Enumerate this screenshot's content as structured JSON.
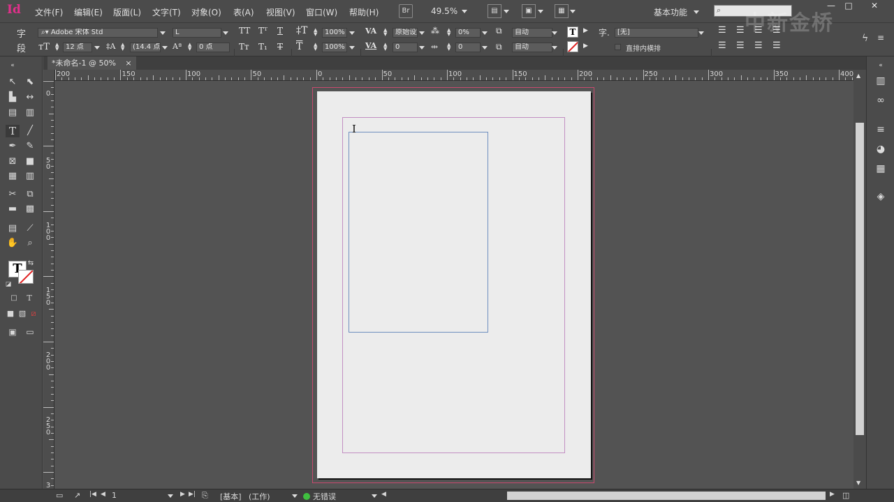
{
  "app": {
    "logo": "Id"
  },
  "menubar": {
    "items": [
      "文件(F)",
      "编辑(E)",
      "版面(L)",
      "文字(T)",
      "对象(O)",
      "表(A)",
      "视图(V)",
      "窗口(W)",
      "帮助(H)"
    ],
    "bridge_label": "Br",
    "zoom_value": "49.5%",
    "workspace_label": "基本功能",
    "window_buttons": [
      "—",
      "□",
      "✕"
    ]
  },
  "control": {
    "char_mode": "字",
    "para_mode": "段",
    "font_family": "Adobe 宋体 Std",
    "font_style": "L",
    "font_size": "12 点",
    "leading": "(14.4 点)",
    "vertical_scale": "100%",
    "horizontal_scale": "100%",
    "kerning": "原始设定",
    "tracking": "0",
    "char_spacing": "0%",
    "baseline_shift": "0 点",
    "tsume": "0",
    "aki_before": "自动",
    "aki_after": "自动",
    "char_style": "[无]",
    "char_style_label": "字.",
    "wide_text": "直排内横排",
    "zero": "0"
  },
  "document": {
    "tab_label": "*未命名-1 @ 50%",
    "tab_close": "×"
  },
  "ruler": {
    "h_labels": [
      "200",
      "150",
      "100",
      "50",
      "0",
      "50",
      "100",
      "150",
      "200",
      "250",
      "300",
      "350",
      "400"
    ],
    "v_labels": [
      "0",
      "50",
      "100",
      "150",
      "200",
      "250",
      "3"
    ]
  },
  "statusbar": {
    "page_number": "1",
    "master_info": "[基本]",
    "work_mode": "(工作)",
    "preflight": "无错误"
  },
  "watermark": "中新金桥",
  "colors": {
    "accent": "#e0308a",
    "bleed": "#c84a6e",
    "margin": "#c28fc2",
    "frame": "#6e8fbf"
  }
}
